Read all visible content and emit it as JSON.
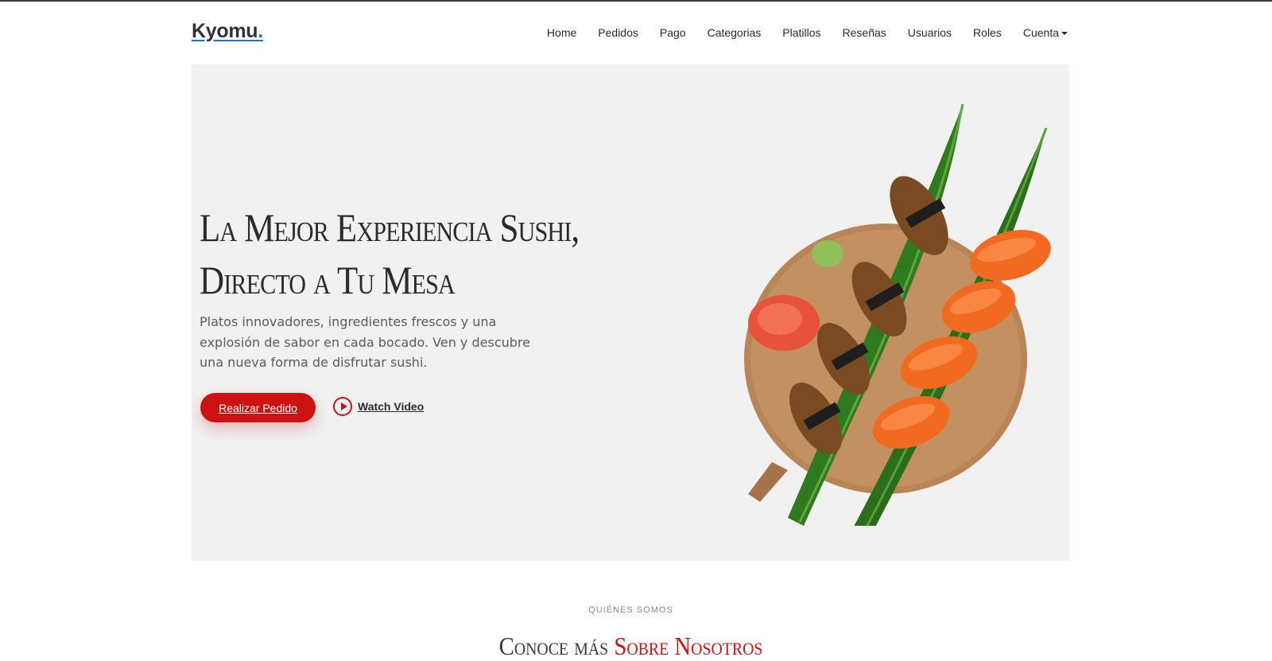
{
  "brand": {
    "name": "Kyomu",
    "dot": "."
  },
  "nav": {
    "items": [
      "Home",
      "Pedidos",
      "Pago",
      "Categorias",
      "Platillos",
      "Reseñas",
      "Usuarios",
      "Roles"
    ],
    "account": "Cuenta"
  },
  "hero": {
    "title_line1": "La Mejor Experiencia Sushi,",
    "title_line2": "Directo a Tu Mesa",
    "description": "Platos innovadores, ingredientes frescos y una explosión de sabor en cada bocado. Ven y descubre una nueva forma de disfrutar sushi.",
    "order_button": "Realizar Pedido",
    "watch_video": "Watch Video"
  },
  "about": {
    "label": "QUIÉNES SOMOS",
    "title_plain": "Conoce más ",
    "title_accent": "Sobre Nosotros"
  },
  "colors": {
    "accent": "#ce1212",
    "brand_underline": "#1f6fd0",
    "hero_bg": "#f1f1f1"
  }
}
